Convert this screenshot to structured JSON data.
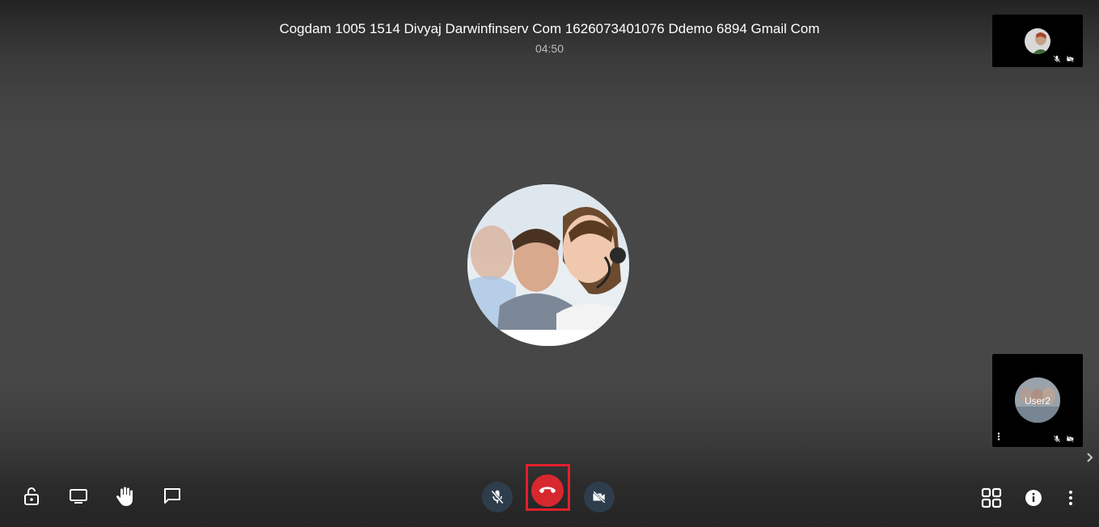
{
  "meeting": {
    "title": "Cogdam 1005 1514 Divyaj Darwinfinserv Com 1626073401076 Ddemo 6894 Gmail Com",
    "duration": "04:50"
  },
  "participants": [
    {
      "label": "",
      "muted": true,
      "video_off": true
    },
    {
      "label": "User2",
      "muted": true,
      "video_off": true
    }
  ],
  "toolbar": {
    "left": [
      "lock-icon",
      "screen-share-icon",
      "raise-hand-icon",
      "chat-icon"
    ],
    "center": [
      "mic-off-icon",
      "hangup-icon",
      "camera-off-icon"
    ],
    "right": [
      "grid-view-icon",
      "info-icon",
      "more-vertical-icon"
    ]
  },
  "colors": {
    "hangup": "#d7282f",
    "highlight_frame": "#e1202a",
    "control_bg": "#2e3d4c"
  }
}
